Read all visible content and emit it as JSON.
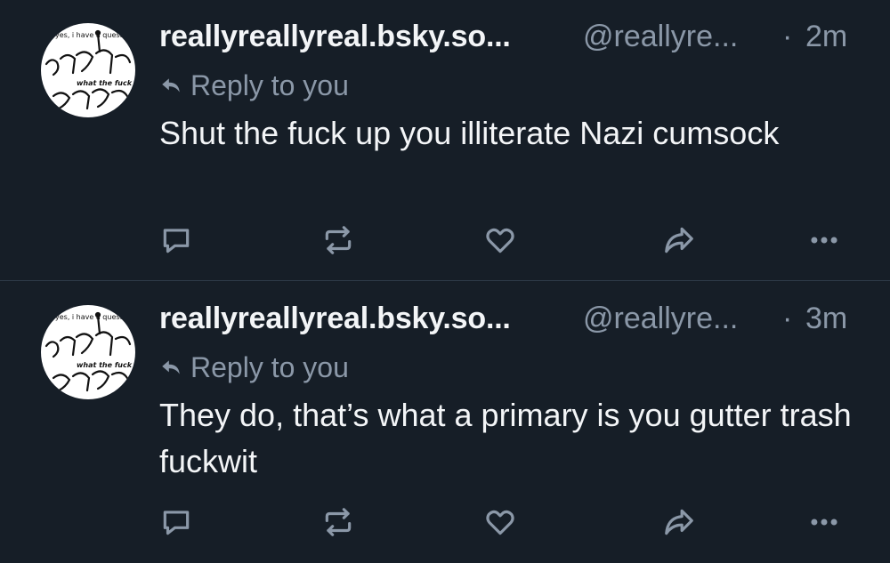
{
  "posts": [
    {
      "display_name": "reallyreallyreal.bsky.so...",
      "handle": "@reallyre...",
      "separator": "·",
      "time": "2m",
      "reply_label": "Reply to you",
      "text": "Shut the fuck up you illiterate Nazi cumsock",
      "avatar_caption_top": "yes, i have a question",
      "avatar_caption_mid": "what the fuck"
    },
    {
      "display_name": "reallyreallyreal.bsky.so...",
      "handle": "@reallyre...",
      "separator": "·",
      "time": "3m",
      "reply_label": "Reply to you",
      "text": "They do, that’s what a primary is you gutter trash fuckwit",
      "avatar_caption_top": "yes, i have a question",
      "avatar_caption_mid": "what the fuck"
    }
  ],
  "icons": {
    "reply_indicator": "reply-arrow-icon",
    "reply": "speech-bubble-icon",
    "repost": "repost-icon",
    "like": "heart-icon",
    "share": "share-arrow-icon",
    "more": "ellipsis-icon"
  },
  "colors": {
    "background": "#161e27",
    "text_primary": "#f3f5f7",
    "text_secondary": "#8b98a8",
    "divider": "#2e3a48"
  }
}
